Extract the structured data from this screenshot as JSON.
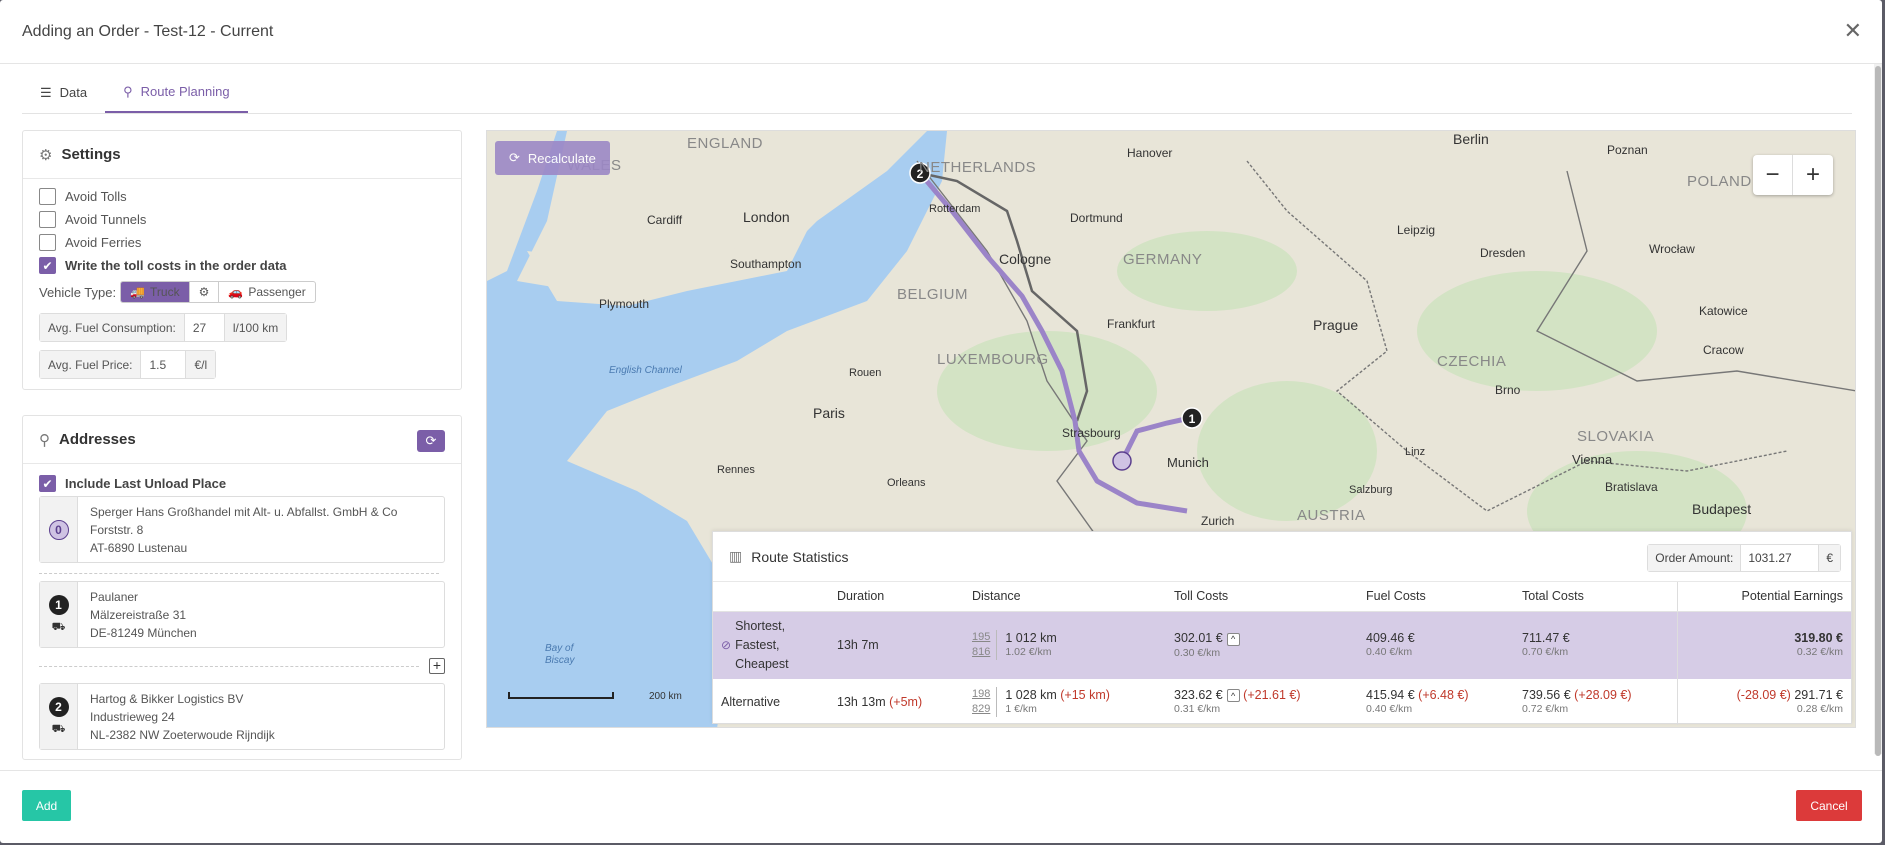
{
  "modal": {
    "title": "Adding an Order - Test-12 - Current",
    "close": "✕",
    "add_label": "Add",
    "cancel_label": "Cancel"
  },
  "tabs": [
    {
      "label": "Data",
      "active": false
    },
    {
      "label": "Route Planning",
      "active": true
    }
  ],
  "settings": {
    "title": "Settings",
    "avoid_tolls": {
      "label": "Avoid Tolls",
      "checked": false
    },
    "avoid_tunnels": {
      "label": "Avoid Tunnels",
      "checked": false
    },
    "avoid_ferries": {
      "label": "Avoid Ferries",
      "checked": false
    },
    "write_toll": {
      "label": "Write the toll costs in the order data",
      "checked": true
    },
    "vehicle_type_label": "Vehicle Type:",
    "vehicle_truck": "Truck",
    "vehicle_passenger": "Passenger",
    "fuel_consumption": {
      "label": "Avg. Fuel Consumption:",
      "value": "27",
      "unit": "l/100 km"
    },
    "fuel_price": {
      "label": "Avg. Fuel Price:",
      "value": "1.5",
      "unit": "€/l"
    }
  },
  "addresses": {
    "title": "Addresses",
    "include_last": {
      "label": "Include Last Unload Place",
      "checked": true
    },
    "items": [
      {
        "index": "0",
        "lines": [
          "Sperger Hans Großhandel mit Alt- u. Abfallst. GmbH & Co",
          "Forststr. 8",
          "AT-6890 Lustenau"
        ]
      },
      {
        "index": "1",
        "lines": [
          "Paulaner",
          "Mälzereistraße 31",
          "DE-81249 München"
        ]
      },
      {
        "index": "2",
        "lines": [
          "Hartog & Bikker Logistics BV",
          "Industrieweg 24",
          "NL-2382 NW Zoeterwoude Rijndijk"
        ]
      }
    ]
  },
  "map": {
    "recalculate": "Recalculate",
    "zoom_out": "−",
    "zoom_in": "+",
    "scale": "200 km",
    "labels": {
      "england": "ENGLAND",
      "wales": "WALES",
      "netherlands": "NETHERLANDS",
      "belgium": "BELGIUM",
      "luxembourg": "LUXEMBOURG",
      "germany": "GERMANY",
      "poland": "POLAND",
      "czechia": "CZECHIA",
      "slovakia": "SLOVAKIA",
      "austria": "AUSTRIA",
      "london": "London",
      "paris": "Paris",
      "berlin": "Berlin",
      "prague": "Prague",
      "munich": "Munich",
      "vienna": "Vienna",
      "budapest": "Budapest",
      "cologne": "Cologne",
      "frankfurt": "Frankfurt",
      "hanover": "Hanover",
      "rotterdam": "Rotterdam",
      "dortmund": "Dortmund",
      "strasbourg": "Strasbourg",
      "bratislava": "Bratislava",
      "cardiff": "Cardiff",
      "plymouth": "Plymouth",
      "southampton": "Southampton",
      "rouen": "Rouen",
      "orleans": "Orleans",
      "rennes": "Rennes",
      "zurich": "Zurich",
      "leipzig": "Leipzig",
      "dresden": "Dresden",
      "wroclaw": "Wrocław",
      "poznan": "Poznan",
      "katowice": "Katowice",
      "krakow": "Cracow",
      "brno": "Brno",
      "linz": "Linz",
      "salzburg": "Salzburg",
      "english_channel": "English Channel",
      "bay_of_biscay": "Bay of\nBiscay"
    }
  },
  "stats": {
    "title": "Route Statistics",
    "order_amount_label": "Order Amount:",
    "order_amount_value": "1031.27",
    "order_amount_unit": "€",
    "headers": [
      "Duration",
      "Distance",
      "Toll Costs",
      "Fuel Costs",
      "Total Costs",
      "Potential Earnings"
    ],
    "rows": [
      {
        "name": "Shortest,\nFastest,\nCheapest",
        "duration": "13h 7m",
        "duration_diff": "",
        "dist_a": "195",
        "dist_b": "816",
        "distance": "1 012 km",
        "distance_diff": "",
        "distance_sub": "1.02 €/km",
        "toll": "302.01 €",
        "toll_diff": "",
        "toll_sub": "0.30 €/km",
        "fuel": "409.46 €",
        "fuel_diff": "",
        "fuel_sub": "0.40 €/km",
        "total": "711.47 €",
        "total_diff": "",
        "total_sub": "0.70 €/km",
        "earn_diff": "",
        "earn": "319.80 €",
        "earn_sub": "0.32 €/km"
      },
      {
        "name": "Alternative",
        "duration": "13h 13m",
        "duration_diff": "(+5m)",
        "dist_a": "198",
        "dist_b": "829",
        "distance": "1 028 km",
        "distance_diff": "(+15 km)",
        "distance_sub": "1 €/km",
        "toll": "323.62 €",
        "toll_diff": "(+21.61 €)",
        "toll_sub": "0.31 €/km",
        "fuel": "415.94 €",
        "fuel_diff": "(+6.48 €)",
        "fuel_sub": "0.40 €/km",
        "total": "739.56 €",
        "total_diff": "(+28.09 €)",
        "total_sub": "0.72 €/km",
        "earn_diff": "(-28.09 €)",
        "earn": "291.71 €",
        "earn_sub": "0.28 €/km"
      }
    ]
  },
  "colors": {
    "accent": "#7b5ea8",
    "add": "#26c6a6",
    "cancel": "#dc3a3a",
    "route": "#9b84c8",
    "alt_route": "#666666"
  }
}
